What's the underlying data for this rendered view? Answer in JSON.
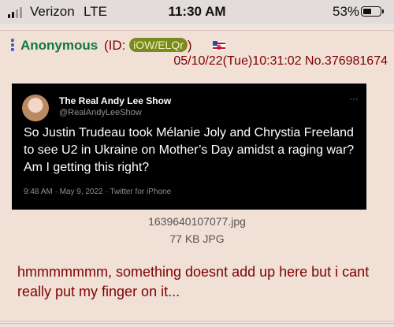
{
  "status_bar": {
    "carrier": "Verizon",
    "network": "LTE",
    "time": "11:30 AM",
    "battery_percent": "53%",
    "battery_level": 0.53
  },
  "post": {
    "menu_icon": "vertical-dots",
    "name": "Anonymous",
    "id_prefix": "(ID: ",
    "id": "iOW/ELQr",
    "id_suffix": ")",
    "flag_icon": "political-flag-icon",
    "datetime": "05/10/22(Tue)10:31:02 No.376981674",
    "image": {
      "filename": "1639640107077.jpg",
      "filesize": "77 KB JPG",
      "tweet": {
        "display_name": "The Real Andy Lee Show",
        "handle": "@RealAndyLeeShow",
        "more": "···",
        "text": "So Justin Trudeau took Mélanie Joly and Chrystia Freeland to see U2 in Ukraine on Mother’s Day amidst a raging war? Am I getting this right?",
        "meta": "9:48 AM · May 9, 2022 · Twitter for iPhone"
      }
    },
    "comment": "hmmmmmmm, something doesnt add up here but i cant really put my finger on it..."
  },
  "colors": {
    "post_bg": "#f0e0d6",
    "name": "#117743",
    "text": "#800000",
    "id_badge": "#7b8a1d",
    "link_blue": "#3256c8"
  }
}
